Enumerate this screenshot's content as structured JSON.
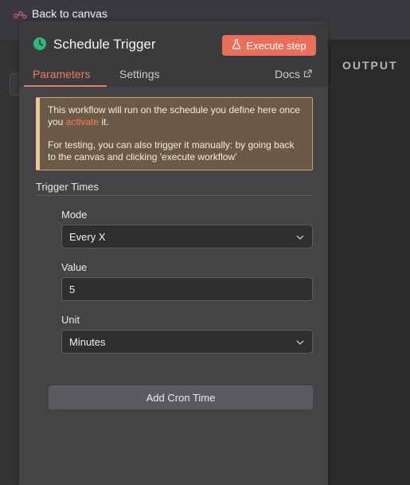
{
  "topbar": {
    "back_label": "Back to canvas"
  },
  "output_panel": {
    "label": "OUTPUT"
  },
  "node": {
    "title": "Schedule Trigger",
    "execute_label": "Execute step",
    "colors": {
      "accent": "#ee7a63",
      "execute_bg": "#ea6f5b",
      "node_icon": "#2fb67c"
    }
  },
  "tabs": [
    {
      "label": "Parameters",
      "active": true
    },
    {
      "label": "Settings",
      "active": false
    }
  ],
  "docs_label": "Docs",
  "notice": {
    "line1_before": "This workflow will run on the schedule you define here once you ",
    "activate_link": "activate",
    "line1_after": " it.",
    "line2": "For testing, you can also trigger it manually: by going back to the canvas and clicking 'execute workflow'"
  },
  "trigger_times": {
    "title": "Trigger Times",
    "fields": [
      {
        "label": "Mode",
        "value": "Every X",
        "type": "select"
      },
      {
        "label": "Value",
        "value": "5",
        "type": "input"
      },
      {
        "label": "Unit",
        "value": "Minutes",
        "type": "select"
      }
    ],
    "add_label": "Add Cron Time"
  },
  "icons": {
    "back": "n8n-logo-icon",
    "node": "clock-icon",
    "execute": "flask-icon",
    "docs": "external-link-icon",
    "select": "chevron-down-icon"
  }
}
